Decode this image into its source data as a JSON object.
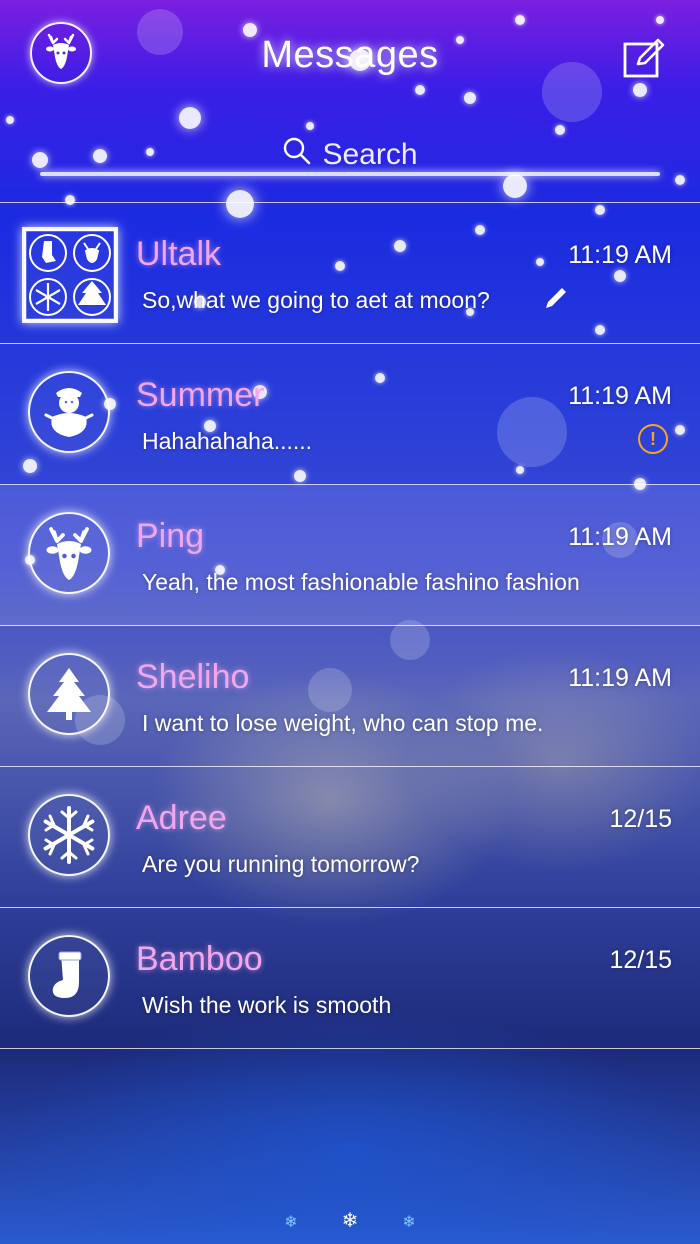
{
  "header": {
    "title": "Messages",
    "profile_icon": "reindeer-icon",
    "compose_icon": "compose-icon"
  },
  "search": {
    "placeholder": "Search",
    "icon": "search-icon"
  },
  "conversations": [
    {
      "name": "Ultalk",
      "time": "11:19 AM",
      "preview": "So,what we going to aet at moon?",
      "avatar": "group-christmas-icon",
      "status": "draft-pencil-icon"
    },
    {
      "name": "Summer",
      "time": "11:19 AM",
      "preview": "Hahahahaha......",
      "avatar": "snowman-icon",
      "status": "alert-icon",
      "status_text": "!"
    },
    {
      "name": "Ping",
      "time": "11:19 AM",
      "preview": "Yeah, the most fashionable fashino fashion",
      "avatar": "reindeer-icon"
    },
    {
      "name": "Sheliho",
      "time": "11:19 AM",
      "preview": "I want to lose weight, who can stop me.",
      "avatar": "christmas-tree-icon"
    },
    {
      "name": "Adree",
      "time": "12/15",
      "preview": "Are you running tomorrow?",
      "avatar": "snowflake-icon"
    },
    {
      "name": "Bamboo",
      "time": "12/15",
      "preview": "Wish the work is smooth",
      "avatar": "stocking-icon"
    }
  ],
  "page_indicator": {
    "icons": [
      "❄",
      "❄",
      "❄"
    ],
    "active_index": 1
  },
  "colors": {
    "name": "#f2a6ee",
    "alert": "#f5a623",
    "background_top": "#7a1fe0",
    "background_mid": "#1b2be0"
  }
}
